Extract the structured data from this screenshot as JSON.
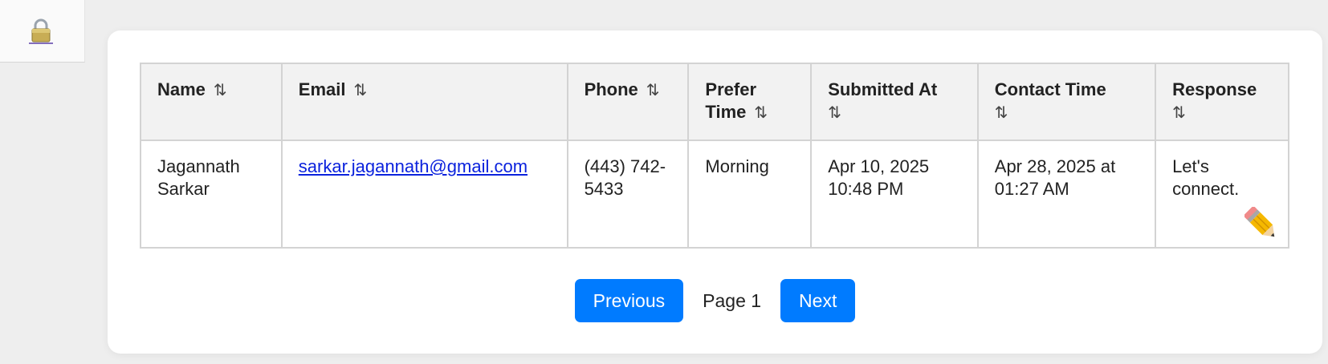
{
  "lock_icon": "lock-icon",
  "table": {
    "headers": [
      {
        "label": "Name",
        "sort_icon": "⇅"
      },
      {
        "label": "Email",
        "sort_icon": "⇅"
      },
      {
        "label": "Phone",
        "sort_icon": "⇅"
      },
      {
        "label": "Prefer Time",
        "sort_icon": "⇅"
      },
      {
        "label": "Submitted At",
        "sort_icon": "⇅"
      },
      {
        "label": "Contact Time",
        "sort_icon": "⇅"
      },
      {
        "label": "Response",
        "sort_icon": "⇅"
      }
    ],
    "rows": [
      {
        "name": "Jagannath Sarkar",
        "email": "sarkar.jagannath@gmail.com",
        "phone": "(443) 742-5433",
        "prefer_time": "Morning",
        "submitted_at": "Apr 10, 2025 10:48 PM",
        "contact_time": "Apr 28, 2025 at 01:27 AM",
        "response": "Let's connect.",
        "edit_icon": "pencil-icon"
      }
    ]
  },
  "pagination": {
    "previous_label": "Previous",
    "page_label": "Page 1",
    "next_label": "Next"
  },
  "colors": {
    "accent": "#007bff",
    "link": "#0b22dd",
    "header_bg": "#f2f2f2"
  }
}
